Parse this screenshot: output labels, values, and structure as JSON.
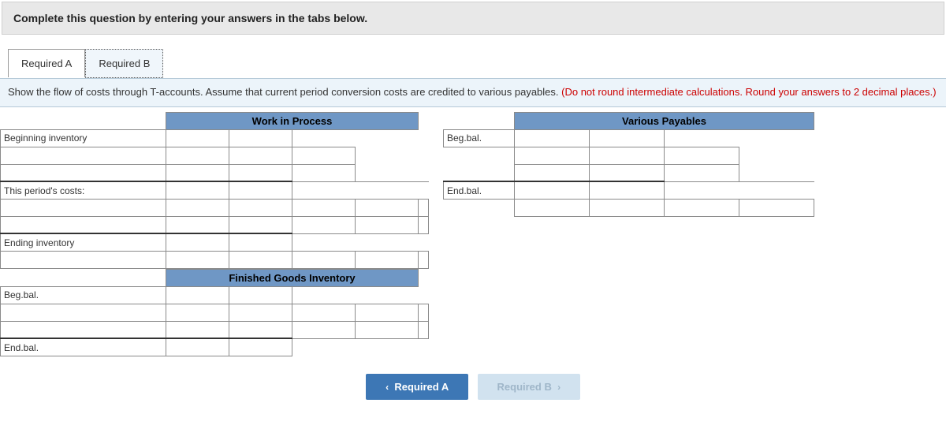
{
  "header": "Complete this question by entering your answers in the tabs below.",
  "tabs": {
    "a": "Required A",
    "b": "Required B"
  },
  "instruction_main": "Show the flow of costs through T-accounts. Assume that current period conversion costs are credited to various payables. ",
  "instruction_red": "(Do not round intermediate calculations. Round your answers to 2 decimal places.)",
  "wip": {
    "title": "Work in Process",
    "row_begin": "Beginning inventory",
    "row_period": "This period's costs:",
    "row_end": "Ending inventory"
  },
  "fgi": {
    "title": "Finished Goods Inventory",
    "row_beg": "Beg.bal.",
    "row_end": "End.bal."
  },
  "vp": {
    "title": "Various Payables",
    "row_beg": "Beg.bal.",
    "row_end": "End.bal."
  },
  "nav": {
    "prev": "Required A",
    "next": "Required B"
  }
}
